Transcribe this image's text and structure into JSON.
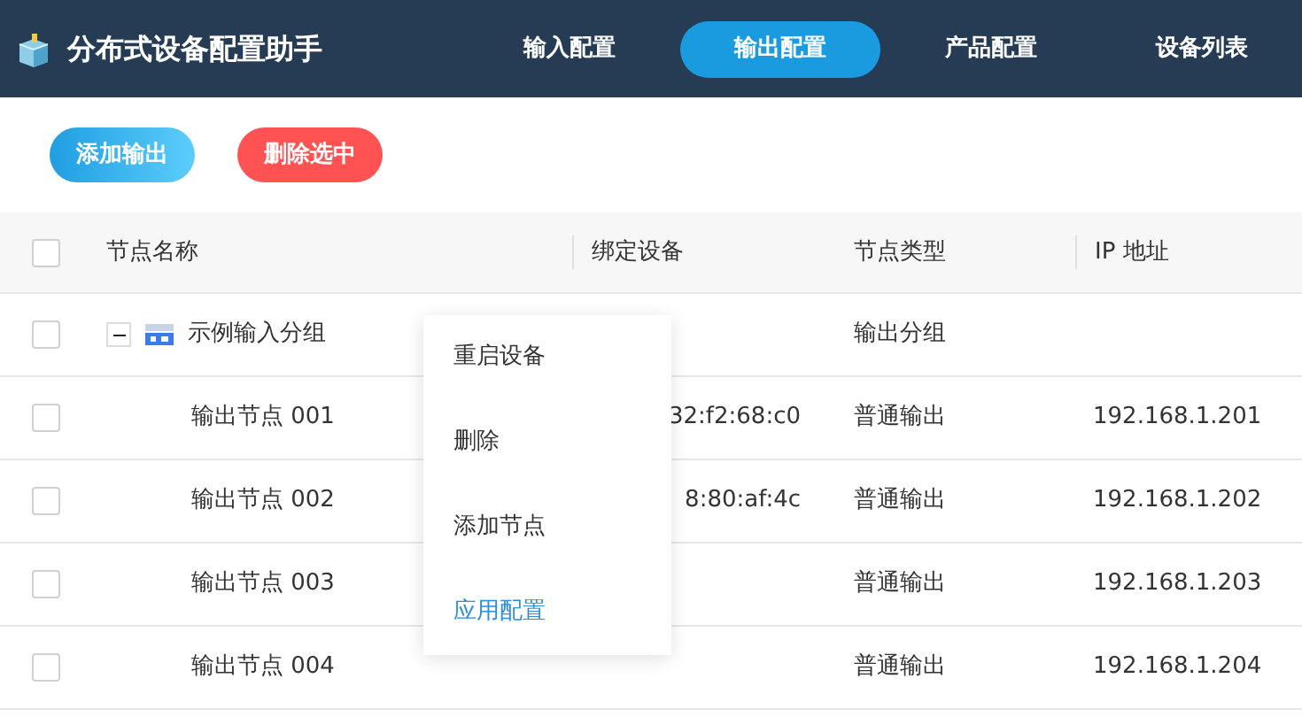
{
  "app": {
    "title": "分布式设备配置助手"
  },
  "nav": [
    {
      "label": "输入配置",
      "selected": false
    },
    {
      "label": "输出配置",
      "selected": true
    },
    {
      "label": "产品配置",
      "selected": false
    },
    {
      "label": "设备列表",
      "selected": false
    }
  ],
  "toolbar": [
    {
      "label": "添加输出",
      "kind": "primary"
    },
    {
      "label": "删除选中",
      "kind": "danger"
    }
  ],
  "table": {
    "header_checked": false,
    "columns": [
      "节点名称",
      "绑定设备",
      "节点类型",
      "IP 地址"
    ],
    "rows": [
      {
        "name": "示例输入分组",
        "type": "输出分组",
        "checked": false,
        "expanded": true,
        "children": [
          {
            "name": "输出节点 001",
            "device": "32:f2:68:c0",
            "type": "普通输出",
            "ip": "192.168.1.201",
            "checked": false
          },
          {
            "name": "输出节点 002",
            "device": "8:80:af:4c",
            "type": "普通输出",
            "ip": "192.168.1.202",
            "checked": false
          },
          {
            "name": "输出节点 003",
            "type": "普通输出",
            "ip": "192.168.1.203",
            "checked": false
          },
          {
            "name": "输出节点 004",
            "type": "普通输出",
            "ip": "192.168.1.204",
            "checked": false
          }
        ]
      }
    ]
  },
  "context_menu": [
    {
      "label": "重启设备",
      "selected": false
    },
    {
      "label": "删除",
      "selected": false
    },
    {
      "label": "添加节点",
      "selected": false
    },
    {
      "label": "应用配置",
      "selected": true
    }
  ]
}
